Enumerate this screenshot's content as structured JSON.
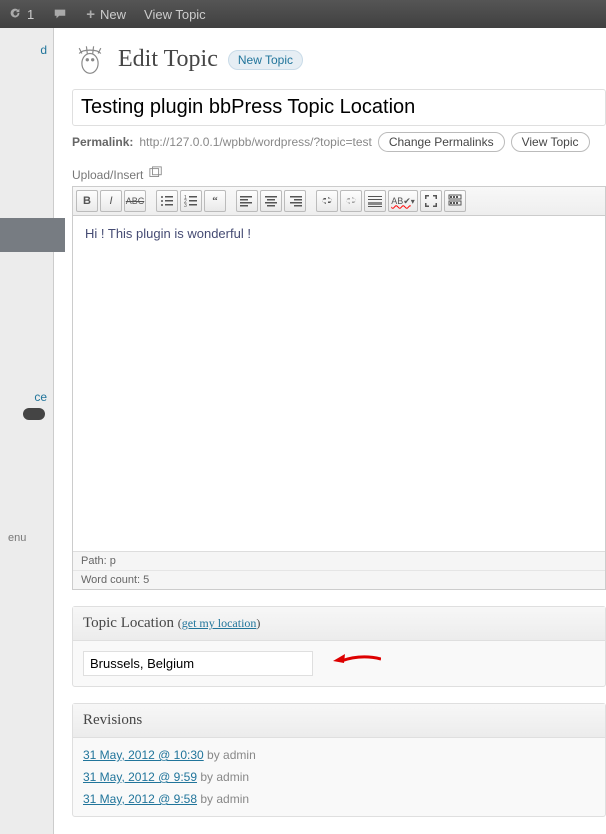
{
  "adminbar": {
    "refresh_count": "1",
    "new_label": "New",
    "view_label": "View Topic"
  },
  "sidebar": {
    "frag1": "d",
    "frag2": "ce",
    "collapse": "enu"
  },
  "heading": {
    "title": "Edit Topic",
    "new_pill": "New Topic"
  },
  "title_field": {
    "value": "Testing plugin bbPress Topic Location"
  },
  "permalink": {
    "label": "Permalink:",
    "url": "http://127.0.0.1/wpbb/wordpress/?topic=test",
    "change": "Change Permalinks",
    "view": "View Topic"
  },
  "upload": {
    "label": "Upload/Insert"
  },
  "editor": {
    "content": "Hi ! This plugin is wonderful !",
    "path_label": "Path:",
    "path_value": "p",
    "wordcount_label": "Word count:",
    "wordcount_value": "5"
  },
  "location_box": {
    "title": "Topic Location",
    "getlink": "get my location",
    "value": "Brussels, Belgium"
  },
  "revisions": {
    "title": "Revisions",
    "rows": [
      {
        "date": "31 May, 2012 @ 10:30",
        "by": "by admin"
      },
      {
        "date": "31 May, 2012 @ 9:59",
        "by": "by admin"
      },
      {
        "date": "31 May, 2012 @ 9:58",
        "by": "by admin"
      }
    ]
  }
}
